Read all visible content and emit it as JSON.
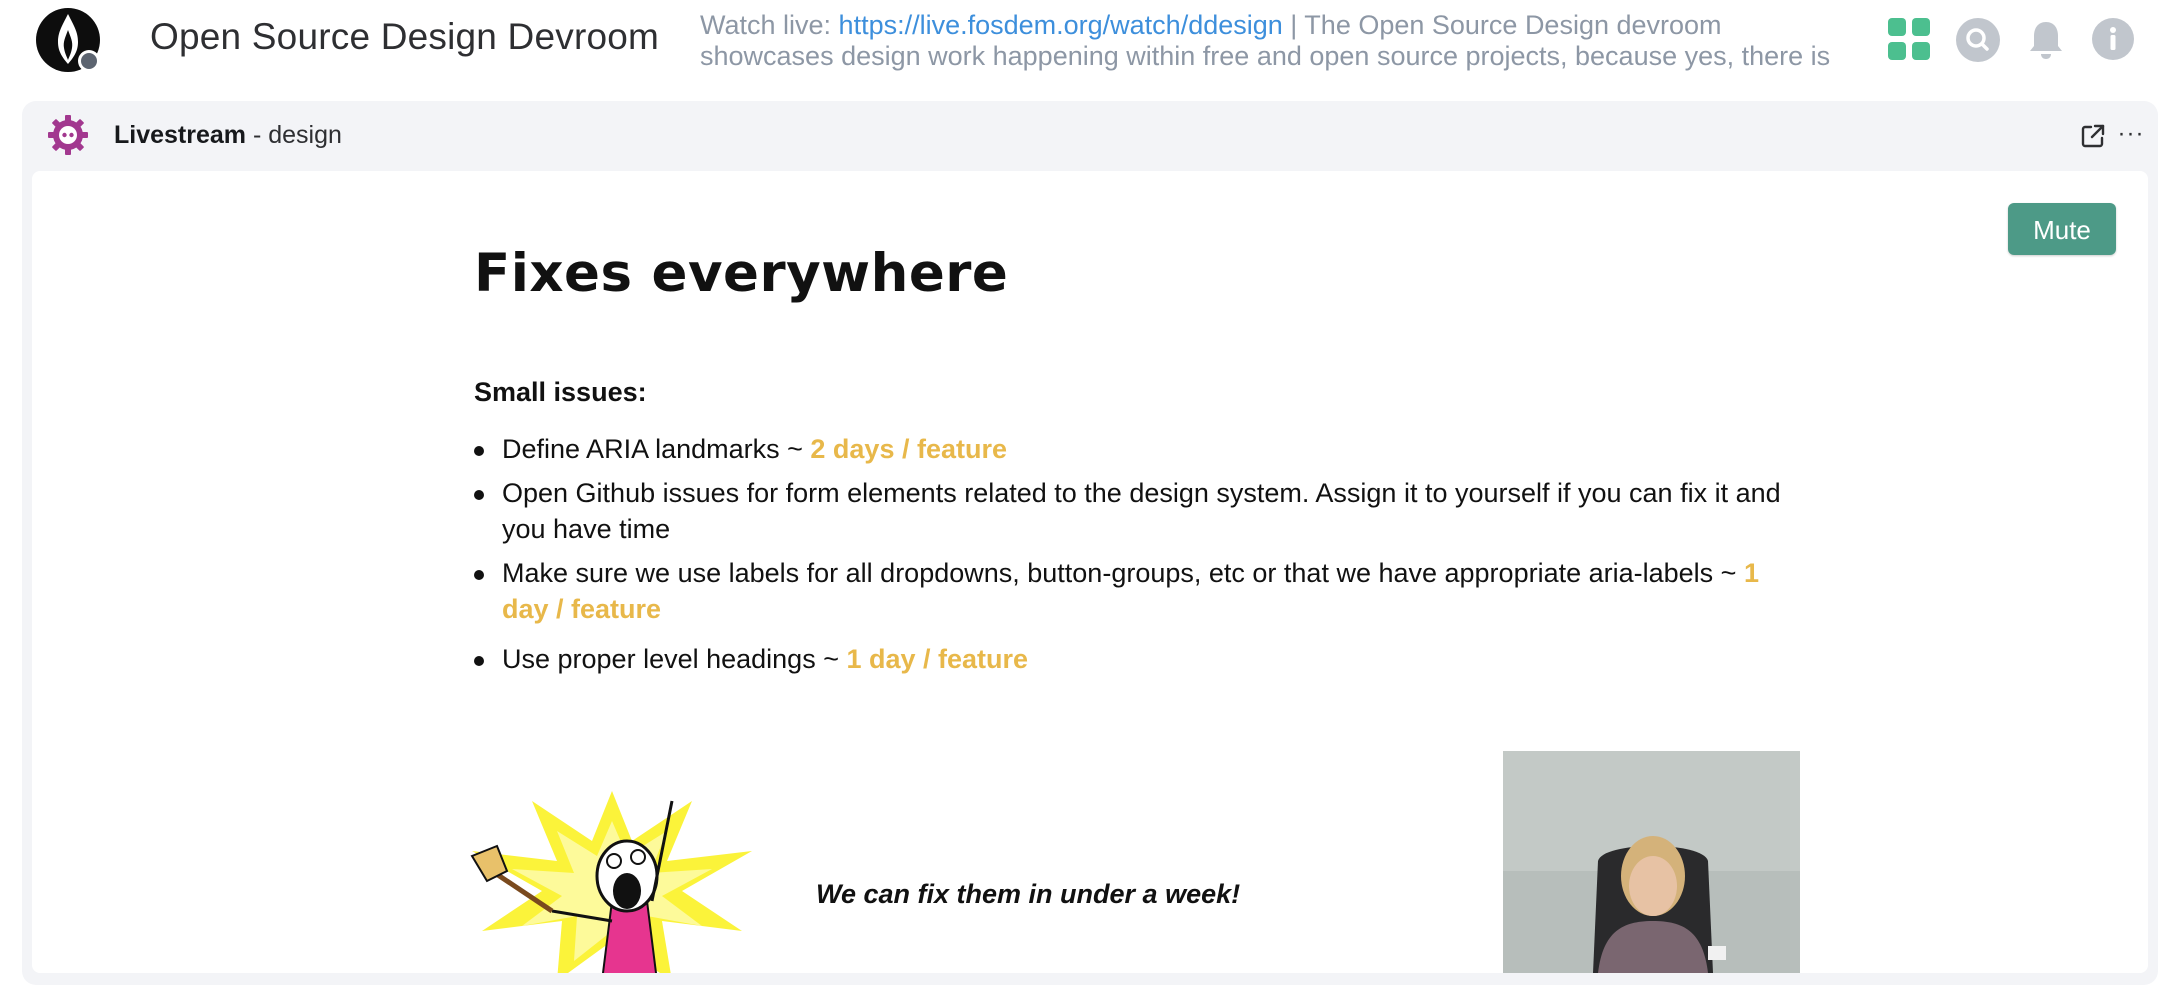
{
  "room": {
    "name": "Open Source Design Devroom",
    "topic_prefix": "Watch live: ",
    "topic_link": "https://live.fosdem.org/watch/ddesign",
    "topic_rest": " | The Open Source Design devroom showcases design work happening within free and open source projects, because yes, there is"
  },
  "header_icons": [
    "apps-icon",
    "search-icon",
    "bell-icon",
    "info-icon"
  ],
  "widget": {
    "title": "Livestream",
    "subtitle": " - design",
    "more_label": "···"
  },
  "player": {
    "mute_label": "Mute"
  },
  "slide": {
    "title": "Fixes everywhere",
    "subtitle": "Small issues:",
    "items": [
      {
        "text": "Define ARIA landmarks ~ ",
        "estimate": "2 days / feature"
      },
      {
        "text": "Open Github issues for form elements related to the design system. Assign it to yourself if you can fix it and you have time",
        "estimate": ""
      },
      {
        "text": "Make sure we use labels for all dropdowns, button-groups, etc or that we have appropriate aria-labels ~ ",
        "estimate": "1 day / feature"
      },
      {
        "text": "Use proper level headings ~ ",
        "estimate": "1 day / feature"
      }
    ],
    "quote": "We can fix them in under a week!"
  },
  "colors": {
    "accent_green": "#4d9a87",
    "apps_green": "#4cbf8f",
    "estimate_yellow": "#e8b84a",
    "link_blue": "#3d8fdc",
    "widget_logo_purple": "#a2388f"
  }
}
